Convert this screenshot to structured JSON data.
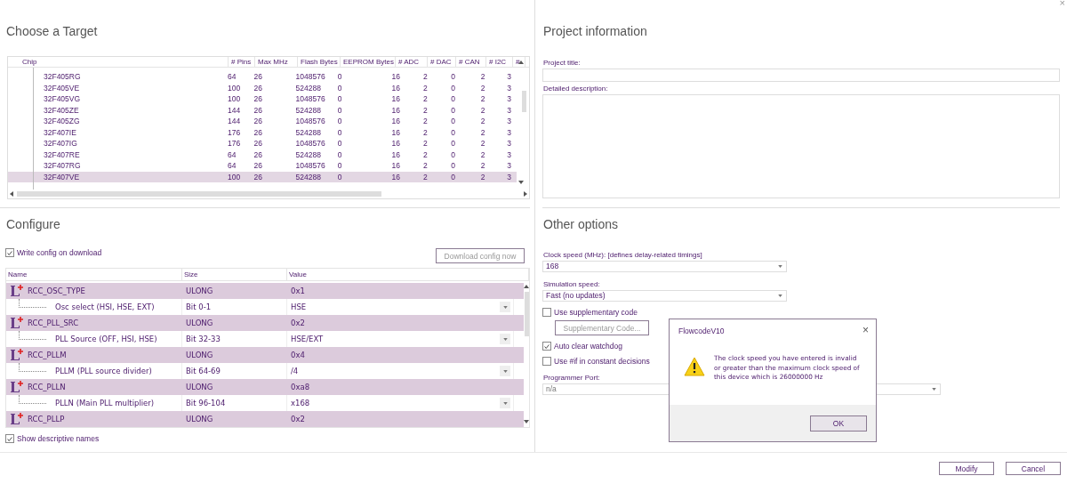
{
  "window": {
    "close": "×"
  },
  "target": {
    "heading": "Choose a Target",
    "columns": [
      "Chip",
      "# Pins",
      "Max MHz",
      "Flash Bytes",
      "EEPROM Bytes",
      "# ADC",
      "# DAC",
      "# CAN",
      "# I2C",
      "#"
    ],
    "rows": [
      {
        "cells": [
          "32F405RG",
          "64",
          "26",
          "1048576",
          "0",
          "16",
          "2",
          "0",
          "2",
          "3"
        ],
        "selected": false
      },
      {
        "cells": [
          "32F405VE",
          "100",
          "26",
          "524288",
          "0",
          "16",
          "2",
          "0",
          "2",
          "3"
        ],
        "selected": false
      },
      {
        "cells": [
          "32F405VG",
          "100",
          "26",
          "1048576",
          "0",
          "16",
          "2",
          "0",
          "2",
          "3"
        ],
        "selected": false
      },
      {
        "cells": [
          "32F405ZE",
          "144",
          "26",
          "524288",
          "0",
          "16",
          "2",
          "0",
          "2",
          "3"
        ],
        "selected": false
      },
      {
        "cells": [
          "32F405ZG",
          "144",
          "26",
          "1048576",
          "0",
          "16",
          "2",
          "0",
          "2",
          "3"
        ],
        "selected": false
      },
      {
        "cells": [
          "32F407IE",
          "176",
          "26",
          "524288",
          "0",
          "16",
          "2",
          "0",
          "2",
          "3"
        ],
        "selected": false
      },
      {
        "cells": [
          "32F407IG",
          "176",
          "26",
          "1048576",
          "0",
          "16",
          "2",
          "0",
          "2",
          "3"
        ],
        "selected": false
      },
      {
        "cells": [
          "32F407RE",
          "64",
          "26",
          "524288",
          "0",
          "16",
          "2",
          "0",
          "2",
          "3"
        ],
        "selected": false
      },
      {
        "cells": [
          "32F407RG",
          "64",
          "26",
          "1048576",
          "0",
          "16",
          "2",
          "0",
          "2",
          "3"
        ],
        "selected": false
      },
      {
        "cells": [
          "32F407VE",
          "100",
          "26",
          "524288",
          "0",
          "16",
          "2",
          "0",
          "2",
          "3"
        ],
        "selected": true
      }
    ]
  },
  "configure": {
    "heading": "Configure",
    "write_config": {
      "label": "Write config on download",
      "checked": true
    },
    "download_button": "Download config now",
    "columns": [
      "Name",
      "Size",
      "Value"
    ],
    "rows": [
      {
        "kind": "register",
        "name": "RCC_OSC_TYPE",
        "size": "ULONG",
        "value": "0x1"
      },
      {
        "kind": "field",
        "name": "Osc select (HSI, HSE, EXT)",
        "size": "Bit 0-1",
        "value": "HSE"
      },
      {
        "kind": "register",
        "name": "RCC_PLL_SRC",
        "size": "ULONG",
        "value": "0x2"
      },
      {
        "kind": "field",
        "name": "PLL Source (OFF, HSI, HSE)",
        "size": "Bit 32-33",
        "value": "HSE/EXT"
      },
      {
        "kind": "register",
        "name": "RCC_PLLM",
        "size": "ULONG",
        "value": "0x4"
      },
      {
        "kind": "field",
        "name": "PLLM (PLL source divider)",
        "size": "Bit 64-69",
        "value": "/4"
      },
      {
        "kind": "register",
        "name": "RCC_PLLN",
        "size": "ULONG",
        "value": "0xa8"
      },
      {
        "kind": "field",
        "name": "PLLN (Main PLL multiplier)",
        "size": "Bit 96-104",
        "value": "x168"
      },
      {
        "kind": "register",
        "name": "RCC_PLLP",
        "size": "ULONG",
        "value": "0x2"
      }
    ],
    "show_names": {
      "label": "Show descriptive names",
      "checked": true
    }
  },
  "project": {
    "heading": "Project information",
    "title_label": "Project title:",
    "description_label": "Detailed description:"
  },
  "other": {
    "heading": "Other options",
    "clock_label": "Clock speed (MHz): [defines delay-related timings]",
    "clock_value": "168",
    "sim_label": "Simulation speed:",
    "sim_value": "Fast (no updates)",
    "options": [
      {
        "label": "Use supplementary code",
        "checked": false
      },
      {
        "label": "Auto clear watchdog",
        "checked": true
      },
      {
        "label": "Use #if in constant decisions",
        "checked": false
      }
    ],
    "supp_button": "Supplementary Code...",
    "port_label": "Programmer Port:",
    "port_value": "n/a"
  },
  "dialog": {
    "title": "FlowcodeV10",
    "close": "×",
    "message": "The clock speed you have entered is invalid or greater than the maximum clock speed of this device which is 26000000 Hz",
    "ok": "OK"
  },
  "buttons": [
    "Modify",
    "Cancel"
  ]
}
